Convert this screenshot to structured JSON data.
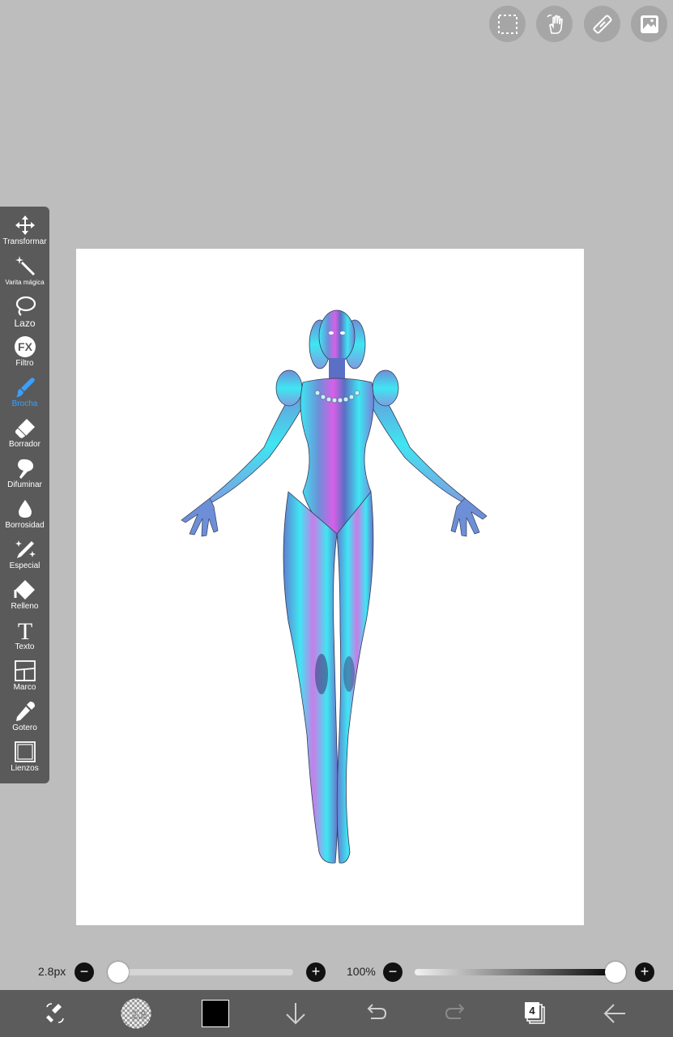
{
  "top_buttons": [
    {
      "name": "selection-icon"
    },
    {
      "name": "hand-icon"
    },
    {
      "name": "ruler-icon"
    },
    {
      "name": "image-icon"
    }
  ],
  "toolbar": {
    "items": [
      {
        "label": "Transformar",
        "icon": "move-arrows-icon"
      },
      {
        "label": "Varita mágica",
        "icon": "magic-wand-icon"
      },
      {
        "label": "Lazo",
        "icon": "lasso-icon"
      },
      {
        "label": "Filtro",
        "icon": "fx-icon",
        "icon_text": "FX"
      },
      {
        "label": "Brocha",
        "icon": "brush-icon",
        "active": true
      },
      {
        "label": "Borrador",
        "icon": "eraser-icon"
      },
      {
        "label": "Difuminar",
        "icon": "blur-finger-icon"
      },
      {
        "label": "Borrosidad",
        "icon": "drop-icon"
      },
      {
        "label": "Especial",
        "icon": "sparkle-pen-icon"
      },
      {
        "label": "Relleno",
        "icon": "bucket-icon"
      },
      {
        "label": "Texto",
        "icon": "text-icon",
        "icon_text": "T"
      },
      {
        "label": "Marco",
        "icon": "frame-icon"
      },
      {
        "label": "Gotero",
        "icon": "eyedropper-icon"
      },
      {
        "label": "Lienzos",
        "icon": "canvas-icon"
      }
    ],
    "active_color": "#3aa0ff"
  },
  "brush_size": {
    "label": "2.8px",
    "value_fraction": 0.0,
    "minus": "−",
    "plus": "+"
  },
  "opacity": {
    "label": "100%",
    "value_fraction": 1.0,
    "minus": "−",
    "plus": "+"
  },
  "bottom_bar": {
    "brush_size_badge": "2.8",
    "color": "#000000",
    "layers_count": "4"
  },
  "colors": {
    "background": "#bdbdbd",
    "panel": "#5a5a5a",
    "figure_cyan": "#3fe6f2",
    "figure_magenta": "#d85fe8",
    "figure_blue": "#6d8fd8"
  }
}
